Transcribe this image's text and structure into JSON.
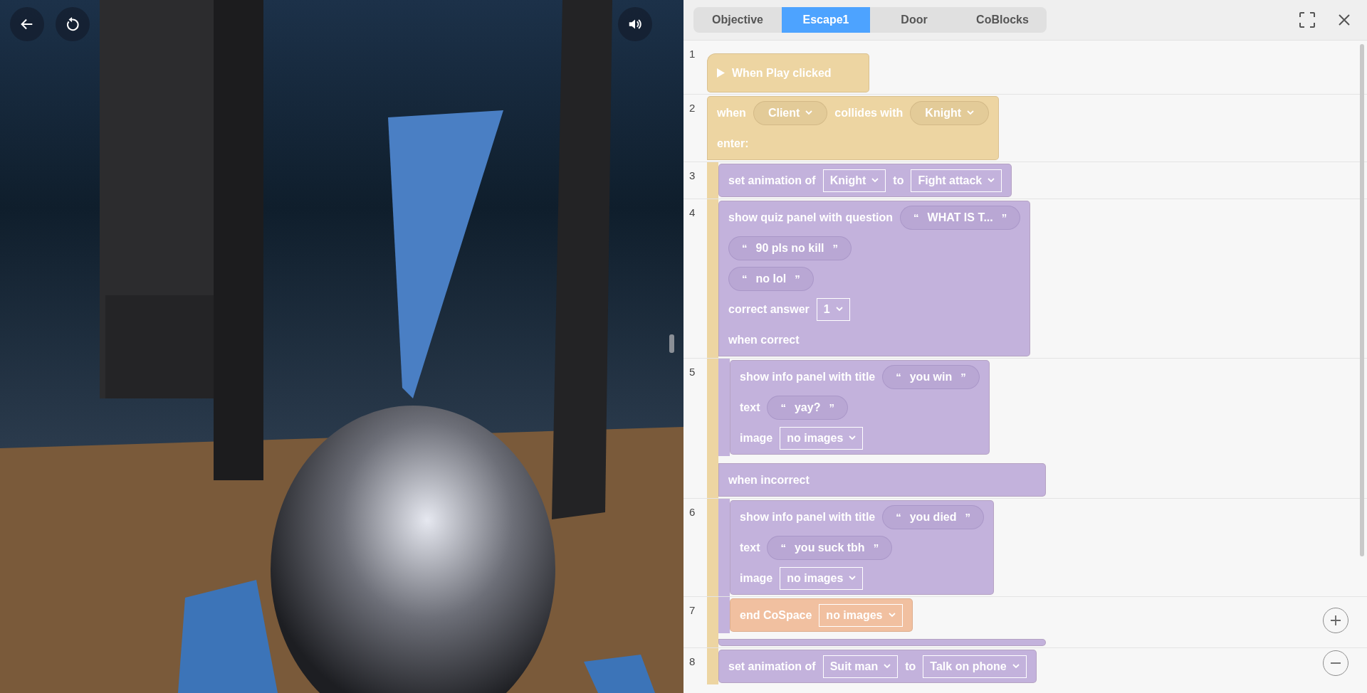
{
  "tabs": [
    {
      "label": "Objective",
      "selected": false
    },
    {
      "label": "Escape1",
      "selected": true
    },
    {
      "label": "Door",
      "selected": false
    },
    {
      "label": "CoBlocks",
      "selected": false
    }
  ],
  "script": [
    {
      "line": "1",
      "color": "#edd5a2",
      "kind": "hat",
      "rows": [
        [
          {
            "kind": "play"
          },
          {
            "kind": "label",
            "text": "When Play clicked"
          }
        ]
      ]
    },
    {
      "line": "2",
      "color": "#edd5a2",
      "kind": "c",
      "rows": [
        [
          {
            "kind": "label",
            "text": "when"
          },
          {
            "kind": "pill",
            "text": "Client"
          },
          {
            "kind": "label",
            "text": "collides with"
          },
          {
            "kind": "pill",
            "text": "Knight"
          }
        ],
        [
          {
            "kind": "label",
            "text": "enter:"
          }
        ]
      ],
      "children": [
        {
          "line": "3",
          "color": "#c3b2dc",
          "kind": "stack",
          "rows": [
            [
              {
                "kind": "label",
                "text": "set animation of"
              },
              {
                "kind": "box",
                "text": "Knight"
              },
              {
                "kind": "label",
                "text": "to"
              },
              {
                "kind": "box",
                "text": "Fight attack"
              }
            ]
          ]
        },
        {
          "line": "4",
          "color": "#c3b2dc",
          "kind": "c",
          "rows": [
            [
              {
                "kind": "label",
                "text": "show quiz panel with question"
              },
              {
                "kind": "string",
                "open": "“",
                "text": "WHAT IS T...",
                "close": "”"
              }
            ],
            [
              {
                "kind": "string",
                "open": "“",
                "text": "90 pls no kill",
                "close": "”"
              }
            ],
            [
              {
                "kind": "string",
                "open": "“",
                "text": "no lol",
                "close": "”"
              }
            ],
            [
              {
                "kind": "label",
                "text": "correct answer"
              },
              {
                "kind": "box",
                "text": "1"
              }
            ],
            [
              {
                "kind": "label",
                "text": "when correct"
              }
            ]
          ],
          "children": [
            {
              "line": "5",
              "color": "#c3b2dc",
              "kind": "stack",
              "rows": [
                [
                  {
                    "kind": "label",
                    "text": "show info panel with title"
                  },
                  {
                    "kind": "string",
                    "open": "“",
                    "text": "you win",
                    "close": "”"
                  }
                ],
                [
                  {
                    "kind": "label",
                    "text": "text"
                  },
                  {
                    "kind": "string",
                    "open": "“",
                    "text": "yay?",
                    "close": "”"
                  }
                ],
                [
                  {
                    "kind": "label",
                    "text": "image"
                  },
                  {
                    "kind": "box",
                    "text": "no images"
                  }
                ]
              ]
            }
          ],
          "else_rows": [
            [
              {
                "kind": "label",
                "text": "when incorrect"
              }
            ]
          ],
          "else_children": [
            {
              "line": "6",
              "color": "#c3b2dc",
              "kind": "stack",
              "rows": [
                [
                  {
                    "kind": "label",
                    "text": "show info panel with title"
                  },
                  {
                    "kind": "string",
                    "open": "“",
                    "text": "you died",
                    "close": "”"
                  }
                ],
                [
                  {
                    "kind": "label",
                    "text": "text"
                  },
                  {
                    "kind": "string",
                    "open": "“",
                    "text": "you suck tbh",
                    "close": "”"
                  }
                ],
                [
                  {
                    "kind": "label",
                    "text": "image"
                  },
                  {
                    "kind": "box",
                    "text": "no images"
                  }
                ]
              ]
            },
            {
              "line": "7",
              "color": "#f1c0a0",
              "kind": "stack",
              "rows": [
                [
                  {
                    "kind": "label",
                    "text": "end CoSpace"
                  },
                  {
                    "kind": "box",
                    "text": "no images"
                  }
                ]
              ]
            }
          ]
        },
        {
          "line": "8",
          "color": "#c3b2dc",
          "kind": "stack",
          "rows": [
            [
              {
                "kind": "label",
                "text": "set animation of"
              },
              {
                "kind": "box",
                "text": "Suit man"
              },
              {
                "kind": "label",
                "text": "to"
              },
              {
                "kind": "box",
                "text": "Talk on phone"
              }
            ]
          ]
        }
      ]
    }
  ]
}
